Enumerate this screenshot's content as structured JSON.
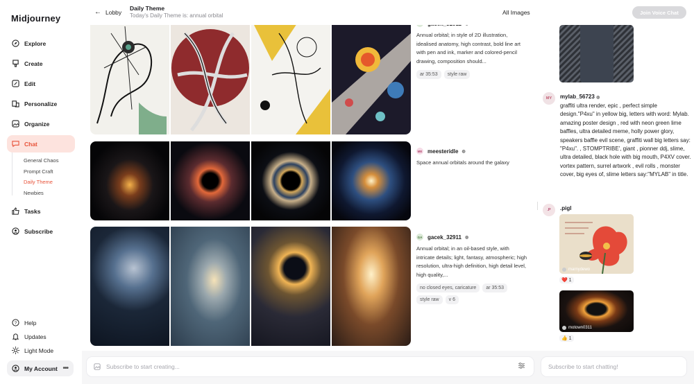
{
  "sidebar": {
    "brand": "Midjourney",
    "nav": [
      {
        "label": "Explore",
        "icon": "compass-icon"
      },
      {
        "label": "Create",
        "icon": "brush-icon"
      },
      {
        "label": "Edit",
        "icon": "edit-icon"
      },
      {
        "label": "Personalize",
        "icon": "personalize-icon"
      },
      {
        "label": "Organize",
        "icon": "image-folder-icon"
      },
      {
        "label": "Chat",
        "icon": "chat-icon"
      }
    ],
    "chat_rooms": [
      "General Chaos",
      "Prompt Craft",
      "Daily Theme",
      "Newbies"
    ],
    "nav_lower": [
      {
        "label": "Tasks",
        "icon": "thumbs-up-icon"
      },
      {
        "label": "Subscribe",
        "icon": "subscribe-icon"
      }
    ],
    "footer": [
      {
        "label": "Help",
        "icon": "help-icon"
      },
      {
        "label": "Updates",
        "icon": "bell-icon"
      },
      {
        "label": "Light Mode",
        "icon": "sun-icon"
      }
    ],
    "account_label": "My Account",
    "accent": "#e8533a"
  },
  "header": {
    "back_label": "Lobby",
    "title": "Daily Theme",
    "subtitle": "Today's Daily Theme is: annual orbital",
    "all_images": "All Images",
    "join_voice": "Join Voice Chat"
  },
  "feed": [
    {
      "author": "gacek_32911",
      "initials": "GA",
      "prompt": "Annual orbital; in style of 2D illustration, idealised anatomy, high contrast, bold line art with pen and ink, marker and colored-pencil drawing, composition should...",
      "chips": [
        "ar 35:53",
        "style raw"
      ]
    },
    {
      "author": "meesteridle",
      "initials": "ME",
      "prompt": "Space annual orbitals around the galaxy",
      "chips": []
    },
    {
      "author": "gacek_32911",
      "initials": "GA",
      "prompt": "Annual orbital; in an oil-based style, with intricate details; light, fantasy, atmospheric; high resolution, ultra-high definition, high detail level, high quality,...",
      "chips": [
        "no closed eyes, caricature",
        "ar 35:53",
        "style raw",
        "v 6"
      ]
    }
  ],
  "chat": [
    {
      "user": "mylab_56723",
      "initials": "MY",
      "text": "graffiti ultra render, epic , perfect simple design.\"P4xu\" in yellow big, letters with word: Mylab. amazing poster design , red with neon green lime baffles, ultra detailed meme, holly power glory, speakers baffle evil scene, graffiti wall big letters say: \"P4xu\". , STOMPTRIBE', giant , pionner ddj, slime, ultra detailed, black hole with big mouth, P4XV cover. vortex pattern, surrel artwork , evil rolls , monster cover, big eyes of, slime letters say:\"MYLAB\" in title."
    },
    {
      "user": ".pigl",
      "initials": ".P",
      "attachments": [
        {
          "caption": "marnydewo",
          "reaction": "❤️ 1"
        },
        {
          "caption": "motown0311",
          "reaction": "👍 1"
        }
      ]
    }
  ],
  "composer": {
    "placeholder": "Subscribe to start creating...",
    "chat_placeholder": "Subscribe to start chatting!"
  }
}
